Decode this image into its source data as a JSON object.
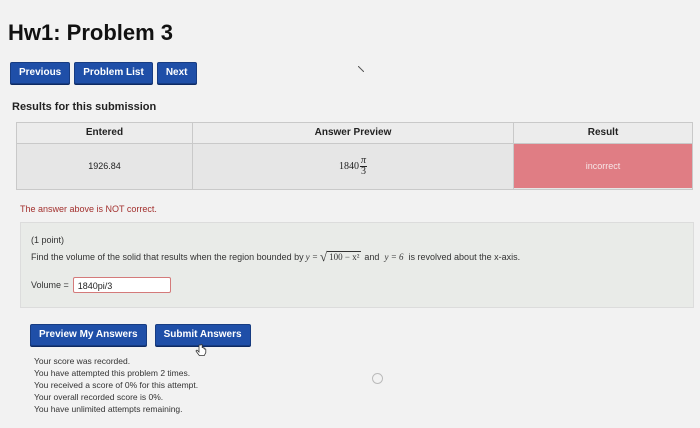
{
  "page": {
    "title": "Hw1: Problem 3"
  },
  "nav": {
    "previous": "Previous",
    "problem_list": "Problem List",
    "next": "Next"
  },
  "results": {
    "heading": "Results for this submission",
    "columns": [
      "Entered",
      "Answer Preview",
      "Result"
    ],
    "row": {
      "entered": "1926.84",
      "preview_whole": "1840",
      "preview_num": "π",
      "preview_den": "3",
      "result": "incorrect"
    },
    "message": "The answer above is NOT correct."
  },
  "problem": {
    "points": "(1 point)",
    "question_pre": "Find the volume of the solid that results when the region bounded by",
    "eq1_lhs": "y =",
    "eq1_radicand": "100 − x²",
    "mid": "and",
    "eq2": "y = 6",
    "question_post": "is revolved about the x-axis.",
    "answer_label": "Volume =",
    "answer_value": "1840pi/3"
  },
  "actions": {
    "preview": "Preview My Answers",
    "submit": "Submit Answers"
  },
  "status": [
    "Your score was recorded.",
    "You have attempted this problem 2 times.",
    "You received a score of 0% for this attempt.",
    "Your overall recorded score is 0%.",
    "You have unlimited attempts remaining."
  ],
  "colors": {
    "button": "#1f4fa8",
    "incorrect": "#e07d84",
    "error_text": "#a3302e"
  }
}
